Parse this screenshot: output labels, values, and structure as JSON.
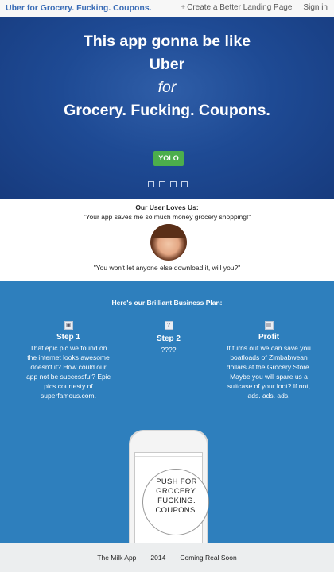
{
  "nav": {
    "brand": "Uber for Grocery. Fucking. Coupons.",
    "create_link": "Create a Better Landing Page",
    "signin": "Sign in"
  },
  "hero": {
    "line1": "This app gonna be like",
    "line2": "Uber",
    "line3": "for",
    "line4": "Grocery. Fucking. Coupons.",
    "button": "YOLO",
    "slides": 4
  },
  "testimonials": {
    "heading": "Our User Loves Us:",
    "quote1": "\"Your app saves me so much money grocery shopping!\"",
    "quote2": "\"You won't let anyone else download it, will you?\""
  },
  "plan": {
    "heading": "Here's our Brilliant Business Plan:",
    "steps": [
      {
        "icon": "image-icon",
        "title": "Step 1",
        "lines": [
          "That epic pic we found on",
          "the internet looks awesome",
          "doesn't it? How could our",
          "app not be successful? Epic",
          "pics courtesty of",
          "superfamous.com."
        ]
      },
      {
        "icon": "question-icon",
        "title": "Step 2",
        "lines": [
          "????"
        ]
      },
      {
        "icon": "bar-chart-icon",
        "title": "Profit",
        "lines": [
          "It turns out we can save you",
          "boatloads of Zimbabwean",
          "dollars at the Grocery Store.",
          "Maybe you will spare us a",
          "suitcase of your loot? If not,",
          "ads. ads. ads."
        ]
      }
    ]
  },
  "phone": {
    "push_lines": [
      "PUSH FOR",
      "GROCERY.",
      "FUCKING.",
      "COUPONS."
    ]
  },
  "footer": {
    "app": "The Milk App",
    "year": "2014",
    "status": "Coming Real Soon"
  },
  "colors": {
    "hero_bg": "#1e4a94",
    "plan_bg": "#2e7fbd",
    "yolo": "#4cae4c",
    "brand": "#3a6cb6"
  }
}
